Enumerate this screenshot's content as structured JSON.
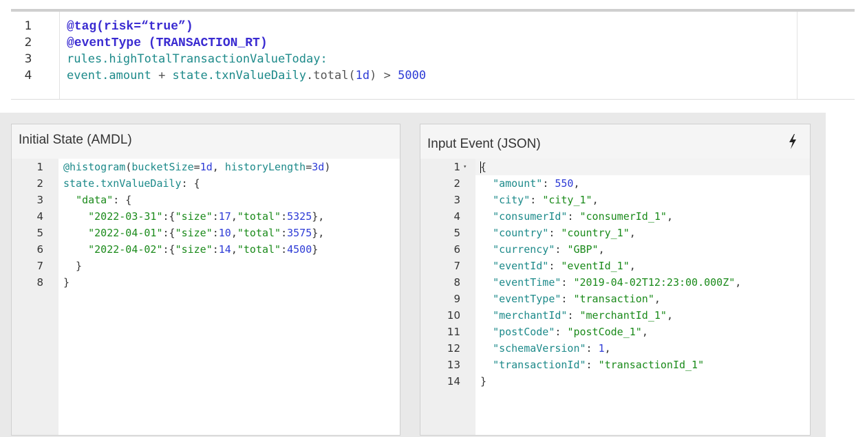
{
  "rule_editor": {
    "line_numbers": [
      "1",
      "2",
      "3",
      "4"
    ],
    "line1": {
      "annotation": "@tag",
      "args": "(risk=“true”)"
    },
    "line2": {
      "annotation": "@eventType",
      "args": " (TRANSACTION_RT)"
    },
    "line3": {
      "text": "rules.highTotalTransactionValueToday:"
    },
    "line4": {
      "lhs": "event.amount",
      "plus": " + ",
      "state": "state.txnValueDaily",
      "method": ".total(",
      "arg": "1d",
      "close": ")",
      "gt": " > ",
      "threshold": "5000"
    }
  },
  "initial_state": {
    "title": "Initial State (AMDL)",
    "line_numbers": [
      "1",
      "2",
      "3",
      "4",
      "5",
      "6",
      "7",
      "8"
    ],
    "l1": {
      "cursor_char": "@",
      "name": "histogram",
      "open": "(",
      "k1": "bucketSize",
      "eq1": "=",
      "v1": "1d",
      "comma": ", ",
      "k2": "historyLength",
      "eq2": "=",
      "v2": "3d",
      "close": ")"
    },
    "l2": {
      "name": "state.txnValueDaily",
      "rest": ": {"
    },
    "l3": {
      "indent": "  ",
      "key": "\"data\"",
      "rest": ": {"
    },
    "rows": [
      {
        "indent": "    ",
        "date": "\"2022-03-31\"",
        "open": ":{",
        "size_key": "\"size\"",
        "colon1": ":",
        "size": "17",
        "comma": ",",
        "total_key": "\"total\"",
        "colon2": ":",
        "total": "5325",
        "close": "},"
      },
      {
        "indent": "    ",
        "date": "\"2022-04-01\"",
        "open": ":{",
        "size_key": "\"size\"",
        "colon1": ":",
        "size": "10",
        "comma": ",",
        "total_key": "\"total\"",
        "colon2": ":",
        "total": "3575",
        "close": "},"
      },
      {
        "indent": "    ",
        "date": "\"2022-04-02\"",
        "open": ":{",
        "size_key": "\"size\"",
        "colon1": ":",
        "size": "14",
        "comma": ",",
        "total_key": "\"total\"",
        "colon2": ":",
        "total": "4500",
        "close": "}"
      }
    ],
    "l7": "  }",
    "l8": "}"
  },
  "input_event": {
    "title": "Input Event (JSON)",
    "action_icon": "bolt-icon",
    "line_numbers": [
      "1",
      "2",
      "3",
      "4",
      "5",
      "6",
      "7",
      "8",
      "9",
      "10",
      "11",
      "12",
      "13",
      "14"
    ],
    "fold_marker": "▾",
    "open_brace": "{",
    "close_brace": "}",
    "fields": [
      {
        "key": "\"amount\"",
        "sep": ": ",
        "value": "550",
        "type": "number",
        "trail": ","
      },
      {
        "key": "\"city\"",
        "sep": ": ",
        "value": "\"city_1\"",
        "type": "string",
        "trail": ","
      },
      {
        "key": "\"consumerId\"",
        "sep": ": ",
        "value": "\"consumerId_1\"",
        "type": "string",
        "trail": ","
      },
      {
        "key": "\"country\"",
        "sep": ": ",
        "value": "\"country_1\"",
        "type": "string",
        "trail": ","
      },
      {
        "key": "\"currency\"",
        "sep": ": ",
        "value": "\"GBP\"",
        "type": "string",
        "trail": ","
      },
      {
        "key": "\"eventId\"",
        "sep": ": ",
        "value": "\"eventId_1\"",
        "type": "string",
        "trail": ","
      },
      {
        "key": "\"eventTime\"",
        "sep": ": ",
        "value": "\"2019-04-02T12:23:00.000Z\"",
        "type": "string",
        "trail": ","
      },
      {
        "key": "\"eventType\"",
        "sep": ": ",
        "value": "\"transaction\"",
        "type": "string",
        "trail": ","
      },
      {
        "key": "\"merchantId\"",
        "sep": ": ",
        "value": "\"merchantId_1\"",
        "type": "string",
        "trail": ","
      },
      {
        "key": "\"postCode\"",
        "sep": ": ",
        "value": "\"postCode_1\"",
        "type": "string",
        "trail": ","
      },
      {
        "key": "\"schemaVersion\"",
        "sep": ": ",
        "value": "1",
        "type": "number",
        "trail": ","
      },
      {
        "key": "\"transactionId\"",
        "sep": ": ",
        "value": "\"transactionId_1\"",
        "type": "string",
        "trail": ""
      }
    ]
  }
}
